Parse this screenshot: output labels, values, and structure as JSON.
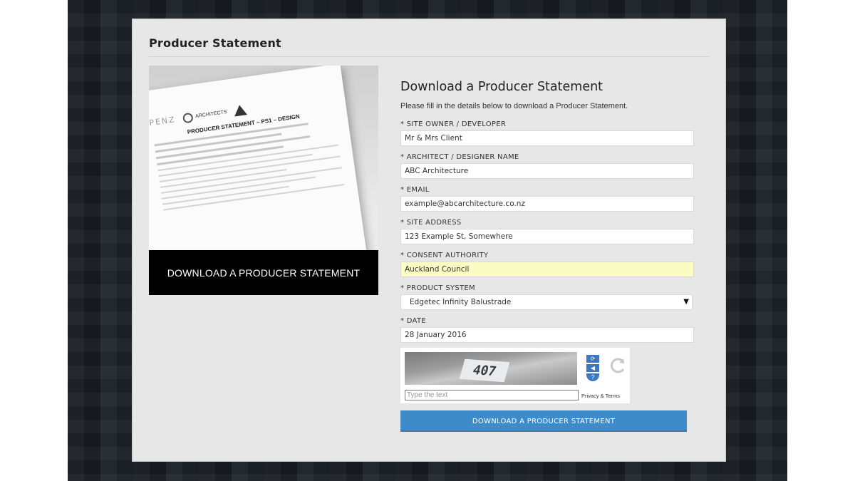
{
  "panel": {
    "title": "Producer Statement"
  },
  "preview": {
    "doc_logo_text": "IPENZ",
    "doc_brand": "ARCHITECTS",
    "doc_heading": "PRODUCER STATEMENT – PS1 – DESIGN",
    "banner_label": "DOWNLOAD A PRODUCER STATEMENT"
  },
  "form": {
    "title": "Download a Producer Statement",
    "intro": "Please fill in the details below to download a Producer Statement.",
    "fields": [
      {
        "label": "* SITE OWNER / DEVELOPER",
        "value": "Mr & Mrs Client"
      },
      {
        "label": "* ARCHITECT / DESIGNER NAME",
        "value": "ABC Architecture"
      },
      {
        "label": "* EMAIL",
        "value": "example@abcarchitecture.co.nz"
      },
      {
        "label": "* SITE ADDRESS",
        "value": "123 Example St, Somewhere"
      },
      {
        "label": "* CONSENT AUTHORITY",
        "value": "Auckland Council"
      },
      {
        "label": "* PRODUCT SYSTEM",
        "value": "Edgetec Infinity Balustrade"
      },
      {
        "label": "* DATE",
        "value": "28 January 2016"
      }
    ],
    "captcha": {
      "image_text": "407",
      "placeholder": "Type the text",
      "privacy_link": "Privacy & Terms",
      "icons": [
        "refresh-icon",
        "audio-icon",
        "help-icon"
      ]
    },
    "submit_label": "DOWNLOAD A PRODUCER STATEMENT"
  },
  "colors": {
    "panel_bg": "#e7e7e7",
    "submit_bg": "#3d8cc9",
    "autofill_bg": "#fbfbc4",
    "banner_bg": "#000000",
    "backdrop": "#1b2027"
  }
}
